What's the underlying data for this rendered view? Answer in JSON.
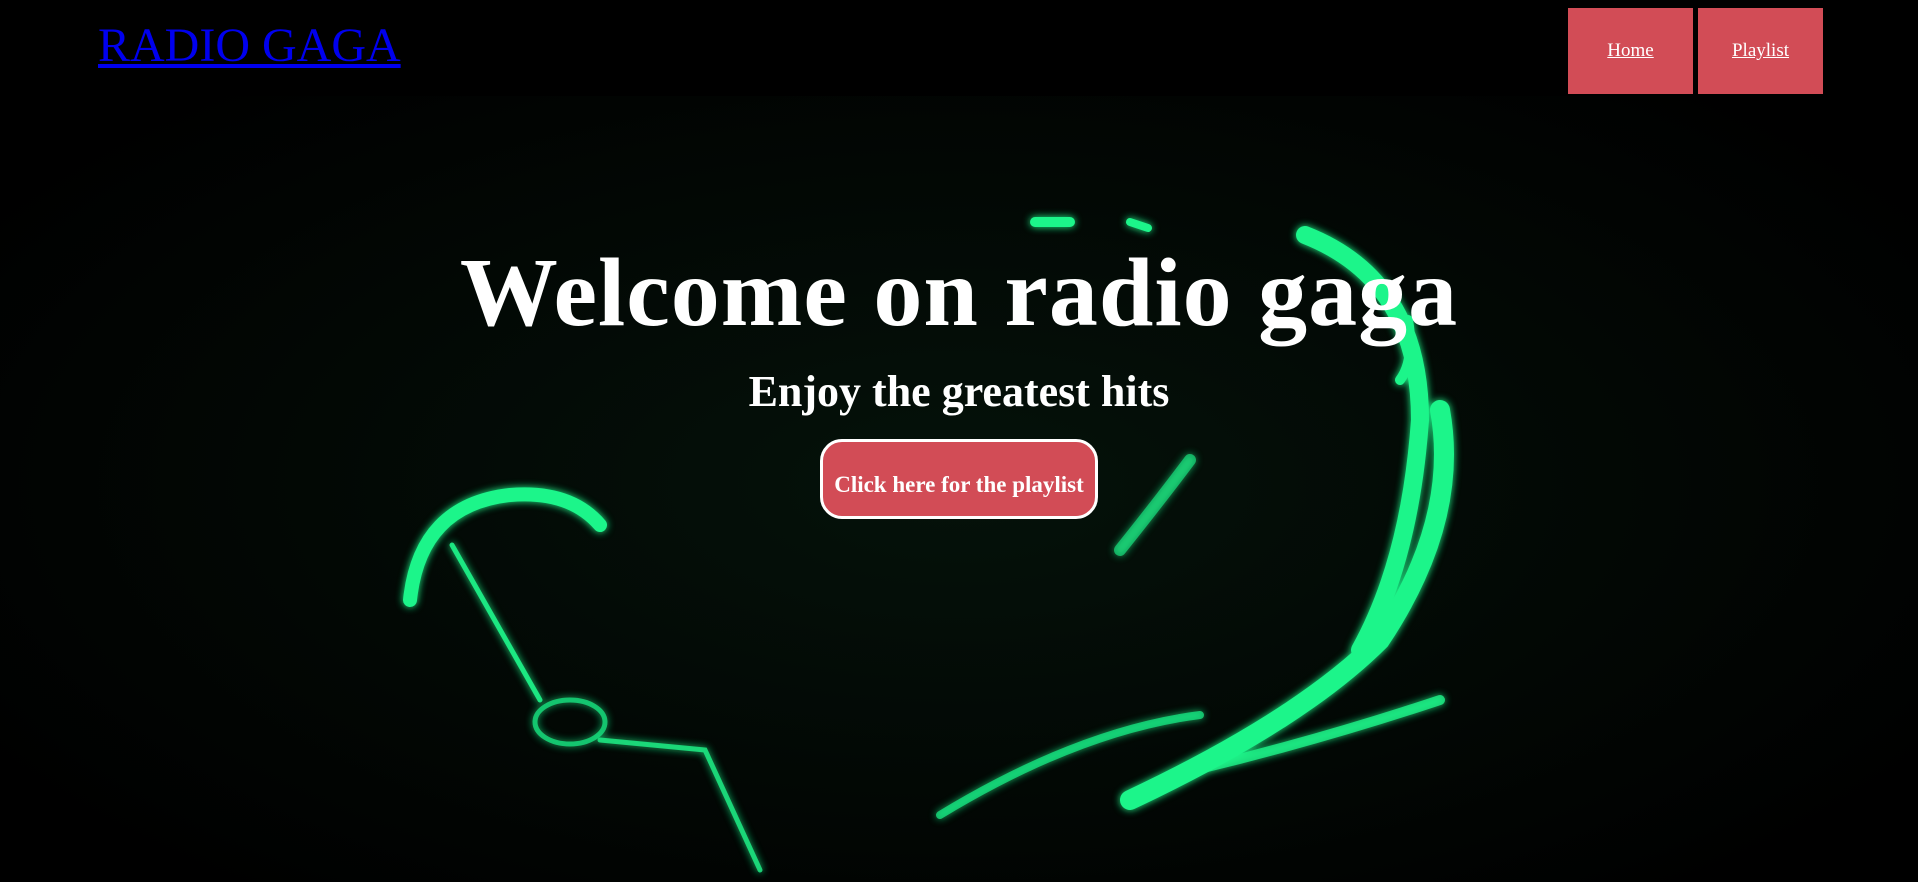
{
  "header": {
    "logo": "RADIO GAGA",
    "nav": [
      {
        "label": "Home"
      },
      {
        "label": "Playlist"
      }
    ]
  },
  "hero": {
    "title": "Welcome on radio gaga",
    "subtitle": "Enjoy the greatest hits",
    "cta_label": "Click here for the playlist"
  },
  "colors": {
    "accent": "#d24c56",
    "background": "#000000",
    "logo_link": "#0000ee",
    "glow": "#1cf58a"
  }
}
